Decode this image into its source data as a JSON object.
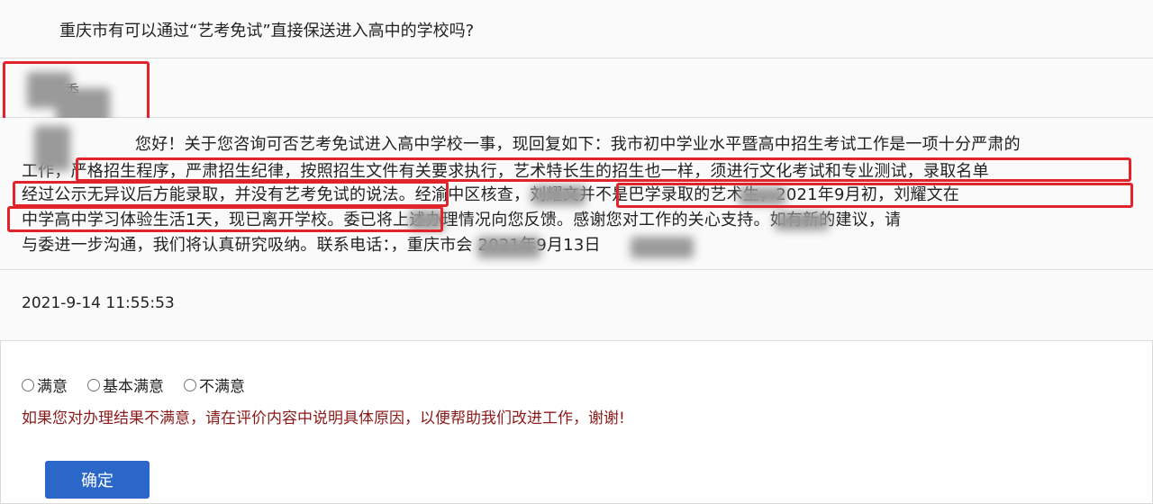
{
  "question": "重庆市有可以通过“艺考免试”直接保送进入高中的学校吗?",
  "department": "教委",
  "answer_lines": [
    "您好！关于您咨询可否艺考免试进入高中学校一事，现回复如下：我市初中学业水平暨高中招生考试工作是一项十分严肃的",
    "工作，严格招生程序，严肃招生纪律，按照招生文件有关要求执行，艺术特长生的招生也一样，须进行文化考试和专业测试，录取名单",
    "经过公示无异议后方能录取，并没有艺考免试的说法。经渝中区核查，刘耀文并不是巴学录取的艺术生，2021年9月初，刘耀文在",
    "中学高中学习体验生活1天，现已离开学校。委已将上述办理情况向您反馈。感谢您对工作的关心支持。如有新的建议，请",
    "与委进一步沟通，我们将认真研究吸纳。联系电话：，重庆市会 2021年9月13日"
  ],
  "reply_time": "2021-9-14 11:55:53",
  "rating_options": [
    "满意",
    "基本满意",
    "不满意"
  ],
  "note": "如果您对办理结果不满意，请在评价内容中说明具体原因，以便帮助我们改进工作，谢谢!",
  "submit_label": "确定"
}
